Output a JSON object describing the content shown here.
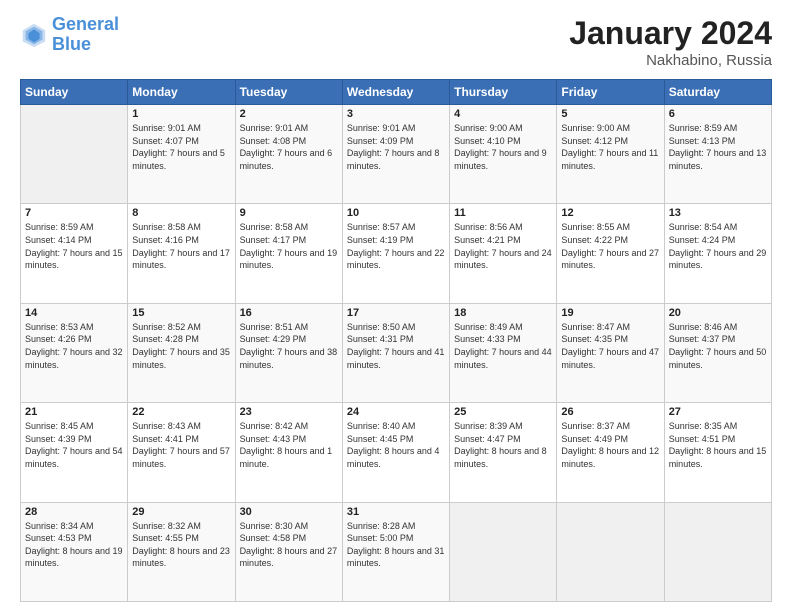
{
  "header": {
    "logo": {
      "line1": "General",
      "line2": "Blue"
    },
    "title": "January 2024",
    "subtitle": "Nakhabino, Russia"
  },
  "weekdays": [
    "Sunday",
    "Monday",
    "Tuesday",
    "Wednesday",
    "Thursday",
    "Friday",
    "Saturday"
  ],
  "weeks": [
    [
      {
        "day": "",
        "sunrise": "",
        "sunset": "",
        "daylight": ""
      },
      {
        "day": "1",
        "sunrise": "Sunrise: 9:01 AM",
        "sunset": "Sunset: 4:07 PM",
        "daylight": "Daylight: 7 hours and 5 minutes."
      },
      {
        "day": "2",
        "sunrise": "Sunrise: 9:01 AM",
        "sunset": "Sunset: 4:08 PM",
        "daylight": "Daylight: 7 hours and 6 minutes."
      },
      {
        "day": "3",
        "sunrise": "Sunrise: 9:01 AM",
        "sunset": "Sunset: 4:09 PM",
        "daylight": "Daylight: 7 hours and 8 minutes."
      },
      {
        "day": "4",
        "sunrise": "Sunrise: 9:00 AM",
        "sunset": "Sunset: 4:10 PM",
        "daylight": "Daylight: 7 hours and 9 minutes."
      },
      {
        "day": "5",
        "sunrise": "Sunrise: 9:00 AM",
        "sunset": "Sunset: 4:12 PM",
        "daylight": "Daylight: 7 hours and 11 minutes."
      },
      {
        "day": "6",
        "sunrise": "Sunrise: 8:59 AM",
        "sunset": "Sunset: 4:13 PM",
        "daylight": "Daylight: 7 hours and 13 minutes."
      }
    ],
    [
      {
        "day": "7",
        "sunrise": "Sunrise: 8:59 AM",
        "sunset": "Sunset: 4:14 PM",
        "daylight": "Daylight: 7 hours and 15 minutes."
      },
      {
        "day": "8",
        "sunrise": "Sunrise: 8:58 AM",
        "sunset": "Sunset: 4:16 PM",
        "daylight": "Daylight: 7 hours and 17 minutes."
      },
      {
        "day": "9",
        "sunrise": "Sunrise: 8:58 AM",
        "sunset": "Sunset: 4:17 PM",
        "daylight": "Daylight: 7 hours and 19 minutes."
      },
      {
        "day": "10",
        "sunrise": "Sunrise: 8:57 AM",
        "sunset": "Sunset: 4:19 PM",
        "daylight": "Daylight: 7 hours and 22 minutes."
      },
      {
        "day": "11",
        "sunrise": "Sunrise: 8:56 AM",
        "sunset": "Sunset: 4:21 PM",
        "daylight": "Daylight: 7 hours and 24 minutes."
      },
      {
        "day": "12",
        "sunrise": "Sunrise: 8:55 AM",
        "sunset": "Sunset: 4:22 PM",
        "daylight": "Daylight: 7 hours and 27 minutes."
      },
      {
        "day": "13",
        "sunrise": "Sunrise: 8:54 AM",
        "sunset": "Sunset: 4:24 PM",
        "daylight": "Daylight: 7 hours and 29 minutes."
      }
    ],
    [
      {
        "day": "14",
        "sunrise": "Sunrise: 8:53 AM",
        "sunset": "Sunset: 4:26 PM",
        "daylight": "Daylight: 7 hours and 32 minutes."
      },
      {
        "day": "15",
        "sunrise": "Sunrise: 8:52 AM",
        "sunset": "Sunset: 4:28 PM",
        "daylight": "Daylight: 7 hours and 35 minutes."
      },
      {
        "day": "16",
        "sunrise": "Sunrise: 8:51 AM",
        "sunset": "Sunset: 4:29 PM",
        "daylight": "Daylight: 7 hours and 38 minutes."
      },
      {
        "day": "17",
        "sunrise": "Sunrise: 8:50 AM",
        "sunset": "Sunset: 4:31 PM",
        "daylight": "Daylight: 7 hours and 41 minutes."
      },
      {
        "day": "18",
        "sunrise": "Sunrise: 8:49 AM",
        "sunset": "Sunset: 4:33 PM",
        "daylight": "Daylight: 7 hours and 44 minutes."
      },
      {
        "day": "19",
        "sunrise": "Sunrise: 8:47 AM",
        "sunset": "Sunset: 4:35 PM",
        "daylight": "Daylight: 7 hours and 47 minutes."
      },
      {
        "day": "20",
        "sunrise": "Sunrise: 8:46 AM",
        "sunset": "Sunset: 4:37 PM",
        "daylight": "Daylight: 7 hours and 50 minutes."
      }
    ],
    [
      {
        "day": "21",
        "sunrise": "Sunrise: 8:45 AM",
        "sunset": "Sunset: 4:39 PM",
        "daylight": "Daylight: 7 hours and 54 minutes."
      },
      {
        "day": "22",
        "sunrise": "Sunrise: 8:43 AM",
        "sunset": "Sunset: 4:41 PM",
        "daylight": "Daylight: 7 hours and 57 minutes."
      },
      {
        "day": "23",
        "sunrise": "Sunrise: 8:42 AM",
        "sunset": "Sunset: 4:43 PM",
        "daylight": "Daylight: 8 hours and 1 minute."
      },
      {
        "day": "24",
        "sunrise": "Sunrise: 8:40 AM",
        "sunset": "Sunset: 4:45 PM",
        "daylight": "Daylight: 8 hours and 4 minutes."
      },
      {
        "day": "25",
        "sunrise": "Sunrise: 8:39 AM",
        "sunset": "Sunset: 4:47 PM",
        "daylight": "Daylight: 8 hours and 8 minutes."
      },
      {
        "day": "26",
        "sunrise": "Sunrise: 8:37 AM",
        "sunset": "Sunset: 4:49 PM",
        "daylight": "Daylight: 8 hours and 12 minutes."
      },
      {
        "day": "27",
        "sunrise": "Sunrise: 8:35 AM",
        "sunset": "Sunset: 4:51 PM",
        "daylight": "Daylight: 8 hours and 15 minutes."
      }
    ],
    [
      {
        "day": "28",
        "sunrise": "Sunrise: 8:34 AM",
        "sunset": "Sunset: 4:53 PM",
        "daylight": "Daylight: 8 hours and 19 minutes."
      },
      {
        "day": "29",
        "sunrise": "Sunrise: 8:32 AM",
        "sunset": "Sunset: 4:55 PM",
        "daylight": "Daylight: 8 hours and 23 minutes."
      },
      {
        "day": "30",
        "sunrise": "Sunrise: 8:30 AM",
        "sunset": "Sunset: 4:58 PM",
        "daylight": "Daylight: 8 hours and 27 minutes."
      },
      {
        "day": "31",
        "sunrise": "Sunrise: 8:28 AM",
        "sunset": "Sunset: 5:00 PM",
        "daylight": "Daylight: 8 hours and 31 minutes."
      },
      {
        "day": "",
        "sunrise": "",
        "sunset": "",
        "daylight": ""
      },
      {
        "day": "",
        "sunrise": "",
        "sunset": "",
        "daylight": ""
      },
      {
        "day": "",
        "sunrise": "",
        "sunset": "",
        "daylight": ""
      }
    ]
  ]
}
